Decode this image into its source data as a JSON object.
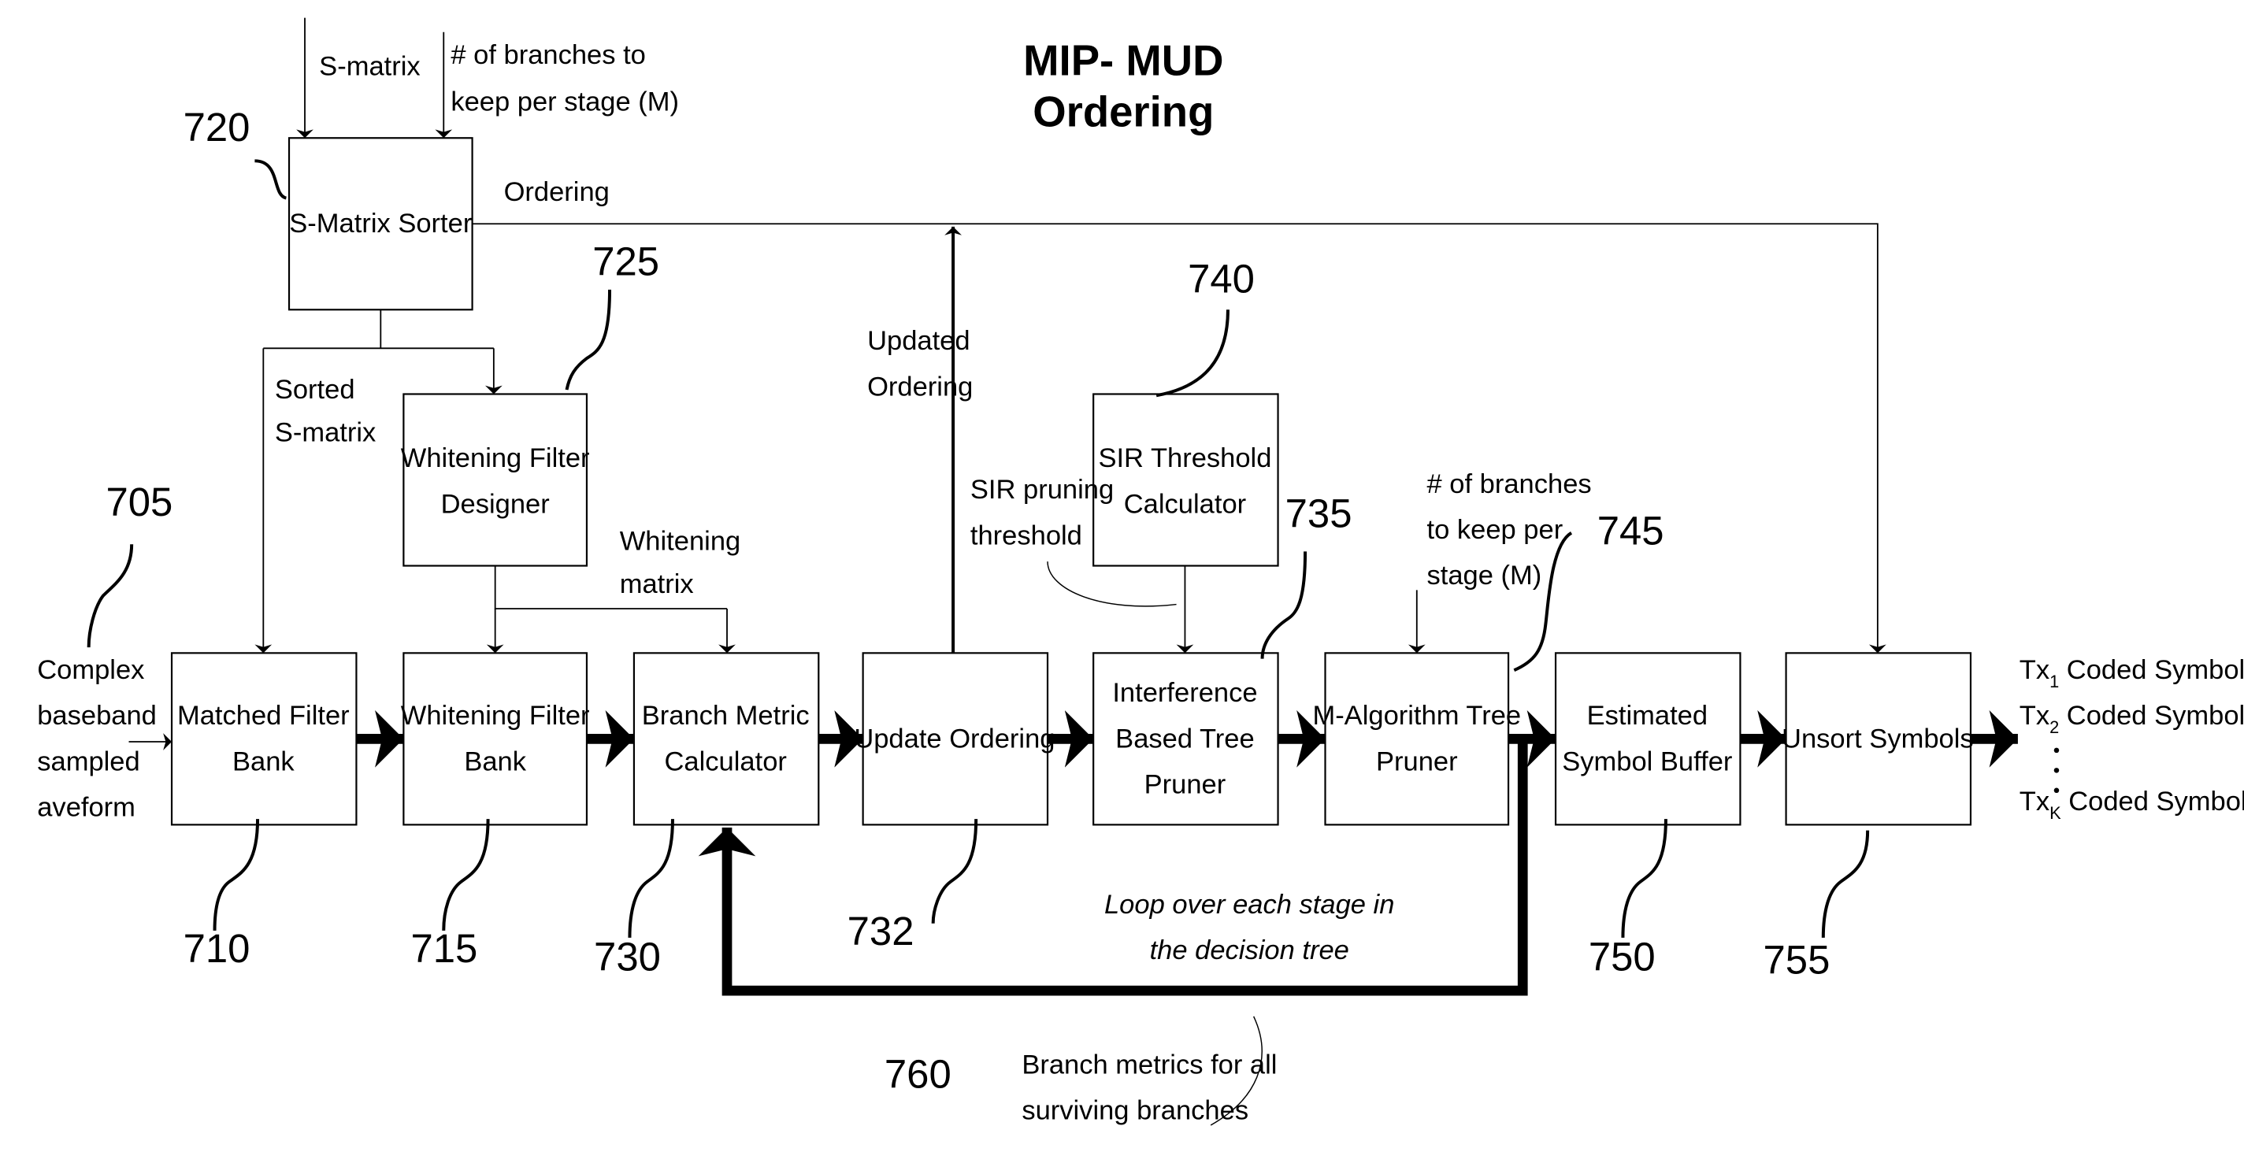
{
  "title": {
    "line1": "MIP- MUD",
    "line2": "Ordering"
  },
  "blocks": [
    {
      "id": "720",
      "label": [
        "S-Matrix Sorter"
      ]
    },
    {
      "id": "725",
      "label": [
        "Whitening Filter",
        "Designer"
      ]
    },
    {
      "id": "740",
      "label": [
        "SIR Threshold",
        "Calculator"
      ]
    },
    {
      "id": "710",
      "label": [
        "Matched Filter",
        "Bank"
      ]
    },
    {
      "id": "715",
      "label": [
        "Whitening Filter",
        "Bank"
      ]
    },
    {
      "id": "730",
      "label": [
        "Branch Metric",
        "Calculator"
      ]
    },
    {
      "id": "732",
      "label": [
        "Update Ordering"
      ]
    },
    {
      "id": "735",
      "label": [
        "Interference",
        "Based Tree",
        "Pruner"
      ]
    },
    {
      "id": "745",
      "label": [
        "M-Algorithm Tree",
        "Pruner"
      ]
    },
    {
      "id": "750",
      "label": [
        "Estimated",
        "Symbol Buffer"
      ]
    },
    {
      "id": "755",
      "label": [
        "Unsort Symbols"
      ]
    }
  ],
  "refs": {
    "r705": "705",
    "r710": "710",
    "r715": "715",
    "r720": "720",
    "r725": "725",
    "r730": "730",
    "r732": "732",
    "r735": "735",
    "r740": "740",
    "r745": "745",
    "r750": "750",
    "r755": "755",
    "r760": "760"
  },
  "signals": {
    "s_matrix": "S-matrix",
    "branches_top": [
      "# of branches to",
      "keep per stage (M)"
    ],
    "ordering": "Ordering",
    "sorted_s_matrix": [
      "Sorted",
      "S-matrix"
    ],
    "whitening_matrix": [
      "Whitening",
      "matrix"
    ],
    "updated_ordering": [
      "Updated",
      "Ordering"
    ],
    "sir_pruning_threshold": [
      "SIR pruning",
      "threshold"
    ],
    "branches_mid": [
      "# of branches",
      "to keep per",
      "stage (M)"
    ],
    "input": [
      "Complex",
      "baseband",
      "sampled",
      "aveform"
    ],
    "loop": [
      "Loop over each stage in",
      "the decision tree"
    ],
    "branch_metrics": [
      "Branch metrics for all",
      "surviving branches"
    ]
  },
  "outputs": [
    {
      "prefix": "Tx",
      "sub": "1",
      "text": " Coded Symbols"
    },
    {
      "prefix": "Tx",
      "sub": "2",
      "text": " Coded Symbols"
    },
    {
      "prefix": "Tx",
      "sub": "K",
      "text": " Coded Symbols"
    }
  ]
}
